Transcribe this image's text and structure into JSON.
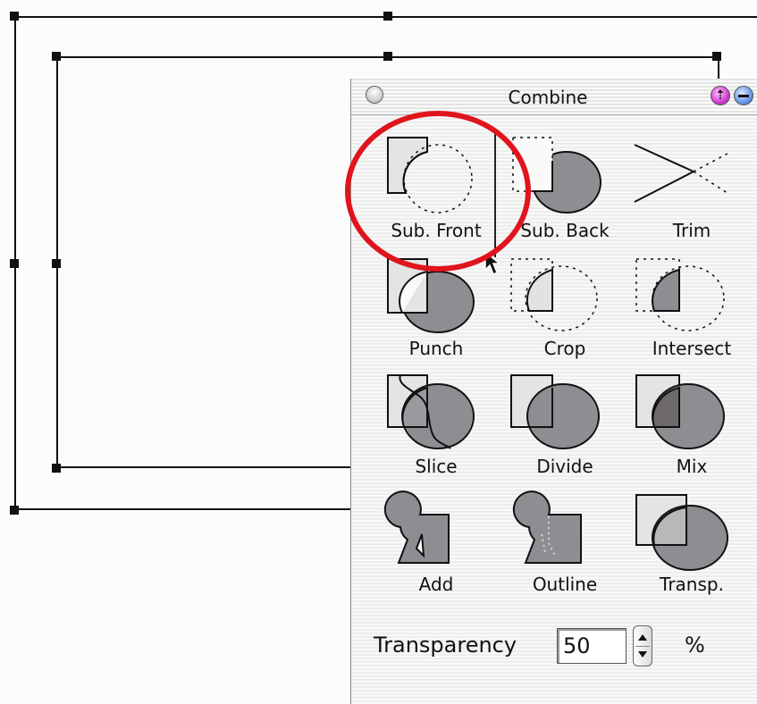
{
  "palette": {
    "title": "Combine",
    "operations": [
      {
        "label": "Sub. Front",
        "icon": "sub-front-icon"
      },
      {
        "label": "Sub. Back",
        "icon": "sub-back-icon"
      },
      {
        "label": "Trim",
        "icon": "trim-icon"
      },
      {
        "label": "Punch",
        "icon": "punch-icon"
      },
      {
        "label": "Crop",
        "icon": "crop-icon"
      },
      {
        "label": "Intersect",
        "icon": "intersect-icon"
      },
      {
        "label": "Slice",
        "icon": "slice-icon"
      },
      {
        "label": "Divide",
        "icon": "divide-icon"
      },
      {
        "label": "Mix",
        "icon": "mix-icon"
      },
      {
        "label": "Add",
        "icon": "add-icon"
      },
      {
        "label": "Outline",
        "icon": "outline-icon"
      },
      {
        "label": "Transp.",
        "icon": "transparency-icon"
      }
    ],
    "transparency": {
      "label": "Transparency",
      "value": "50",
      "unit": "%"
    }
  },
  "colors": {
    "shape_gray": "#8e8e92",
    "shape_light": "#e2e2e2",
    "highlight": "#e0141d"
  }
}
